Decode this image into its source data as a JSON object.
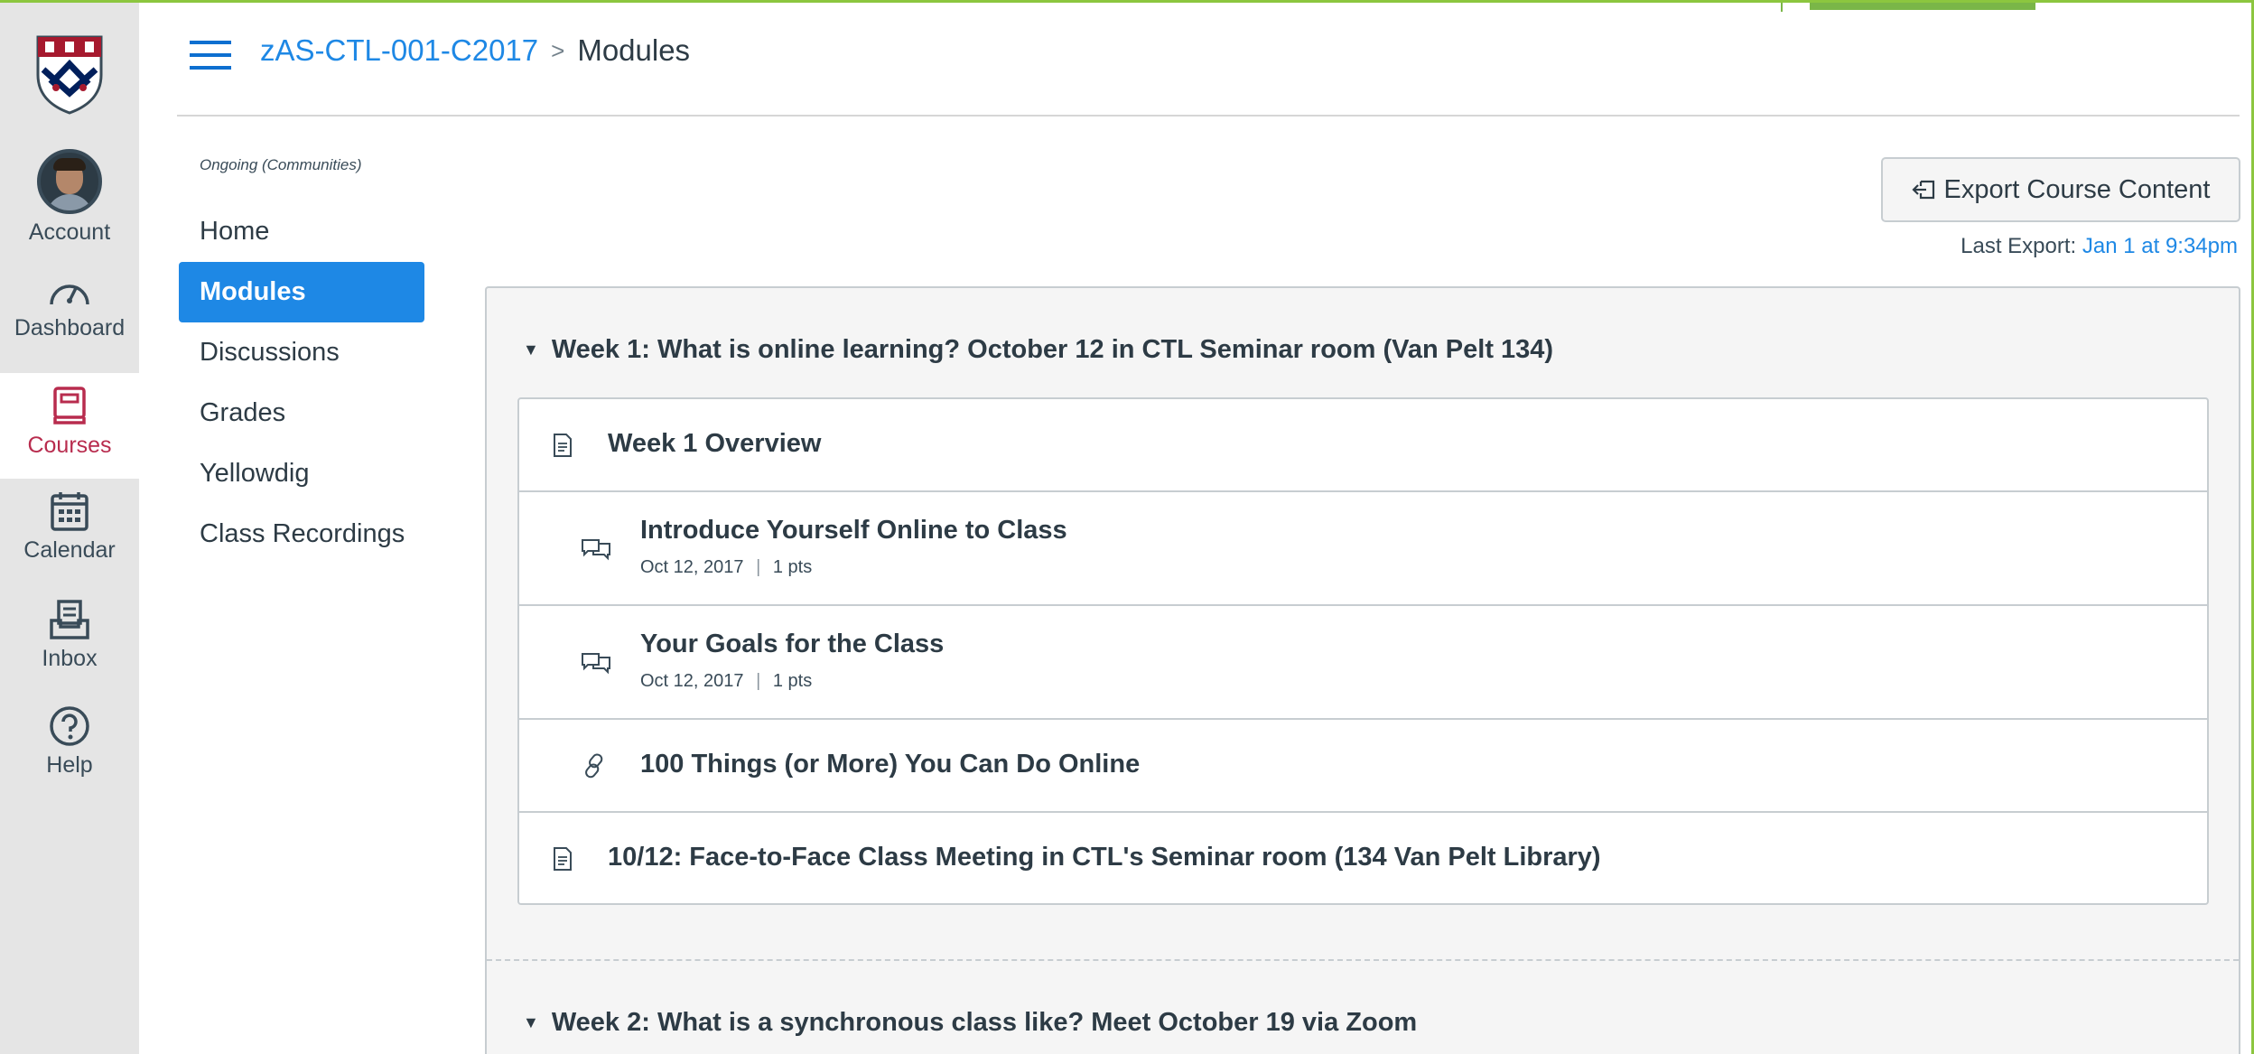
{
  "global_nav": {
    "items": [
      {
        "label": "Account",
        "icon": "avatar"
      },
      {
        "label": "Dashboard",
        "icon": "dashboard-icon"
      },
      {
        "label": "Courses",
        "icon": "courses-icon"
      },
      {
        "label": "Calendar",
        "icon": "calendar-icon"
      },
      {
        "label": "Inbox",
        "icon": "inbox-icon"
      },
      {
        "label": "Help",
        "icon": "help-icon"
      }
    ],
    "active": "Courses"
  },
  "breadcrumb": {
    "course": "zAS-CTL-001-C2017",
    "separator": ">",
    "current": "Modules"
  },
  "course_nav": {
    "term": "Ongoing (Communities)",
    "links": [
      "Home",
      "Modules",
      "Discussions",
      "Grades",
      "Yellowdig",
      "Class Recordings"
    ],
    "active": "Modules"
  },
  "export": {
    "button_label": "Export Course Content",
    "last_export_label": "Last Export:",
    "last_export_when": "Jan 1 at 9:34pm"
  },
  "modules": [
    {
      "title": "Week 1: What is online learning? October 12 in CTL Seminar room (Van Pelt 134)",
      "items": [
        {
          "title": "Week 1 Overview",
          "type": "page",
          "icon": "page-icon"
        },
        {
          "title": "Introduce Yourself Online to Class",
          "type": "discussion",
          "icon": "discussion-icon",
          "date": "Oct 12, 2017",
          "points": "1 pts"
        },
        {
          "title": "Your Goals for the Class",
          "type": "discussion",
          "icon": "discussion-icon",
          "date": "Oct 12, 2017",
          "points": "1 pts"
        },
        {
          "title": "100 Things (or More) You Can Do Online",
          "type": "link",
          "icon": "link-icon"
        },
        {
          "title": "10/12: Face-to-Face Class Meeting in CTL's Seminar room (134 Van Pelt Library)",
          "type": "page",
          "icon": "page-icon"
        }
      ]
    },
    {
      "title": "Week 2: What is a synchronous class like? Meet October 19 via Zoom",
      "items": []
    }
  ],
  "colors": {
    "accent": "#1e88e5",
    "courses_active": "#b82c4e",
    "frame_green": "#8cc63f"
  }
}
